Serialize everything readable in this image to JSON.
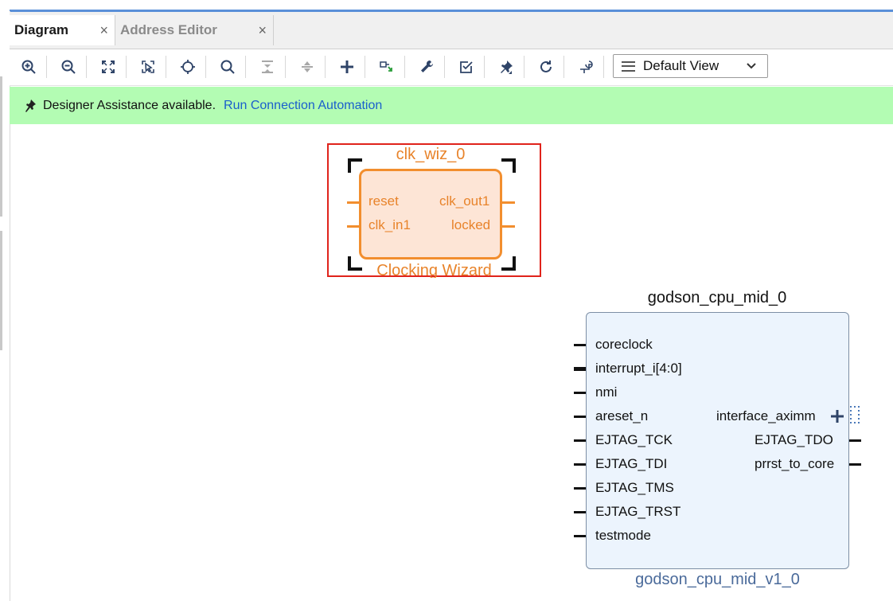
{
  "tabs": [
    {
      "label": "Diagram",
      "active": true
    },
    {
      "label": "Address Editor",
      "active": false
    }
  ],
  "toolbar": {
    "icons": [
      "zoom-in",
      "zoom-out",
      "zoom-fit",
      "zoom-selection",
      "auto-fit",
      "search",
      "collapse",
      "expand",
      "add-ip",
      "make-connection",
      "customize-block",
      "validate",
      "pin",
      "regenerate-layout",
      "optimize-routing"
    ],
    "view_select": "Default View"
  },
  "banner": {
    "message": "Designer Assistance available.",
    "link": "Run Connection Automation",
    "color": "#b3fcb3"
  },
  "blocks": {
    "clk_wiz": {
      "name": "clk_wiz_0",
      "subtitle": "Clocking Wizard",
      "inputs": [
        "reset",
        "clk_in1"
      ],
      "outputs": [
        "clk_out1",
        "locked"
      ],
      "selected": true
    },
    "cpu": {
      "name": "godson_cpu_mid_0",
      "subtitle": "godson_cpu_mid_v1_0",
      "inputs": [
        "coreclock",
        "interrupt_i[4:0]",
        "nmi",
        "areset_n",
        "EJTAG_TCK",
        "EJTAG_TDI",
        "EJTAG_TMS",
        "EJTAG_TRST",
        "testmode"
      ],
      "outputs": [
        "interface_aximm",
        "EJTAG_TDO",
        "prrst_to_core"
      ]
    }
  },
  "colors": {
    "accent": "#5a8fd8",
    "selection": "#e0231b",
    "ip_orange": "#f28e2e",
    "block_fill": "#ecf4fd",
    "link": "#1a5fcc"
  }
}
